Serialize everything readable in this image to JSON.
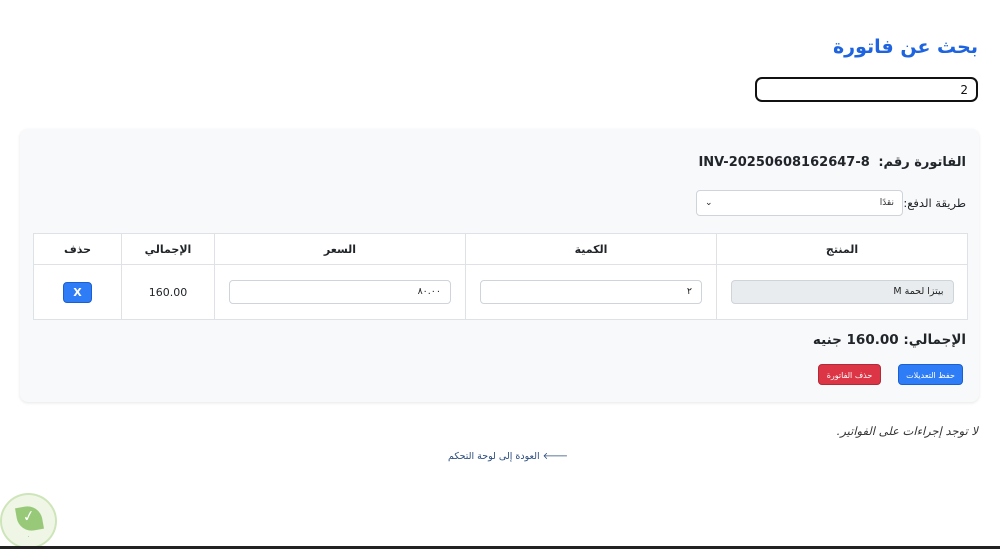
{
  "page": {
    "title": "بحث عن فاتورة"
  },
  "search": {
    "value": "2"
  },
  "invoice": {
    "heading_prefix": "الفاتورة رقم:",
    "number": "INV-20250608162647-8",
    "payment": {
      "label": "طريقة الدفع:",
      "selected": "نقدًا"
    },
    "table": {
      "headers": {
        "product": "المنتج",
        "quantity": "الكمية",
        "price": "السعر",
        "total": "الإجمالي",
        "delete": "حذف"
      },
      "rows": [
        {
          "product": "بيتزا لحمة M",
          "quantity": "٢",
          "price": "٨٠.٠٠",
          "total": "160.00",
          "delete_label": "X"
        }
      ]
    },
    "grand_total": "الإجمالي: 160.00 جنيه",
    "buttons": {
      "save": "حفظ التعديلات",
      "delete": "حذف الفاتورة"
    }
  },
  "footer": {
    "no_actions": "لا توجد إجراءات على الفواتير.",
    "back_link": "العودة إلى لوحة التحكم",
    "back_icon": "arrow-left-icon"
  },
  "colors": {
    "accent": "#2f7df6",
    "danger": "#dc3545",
    "title": "#1e63e0"
  }
}
